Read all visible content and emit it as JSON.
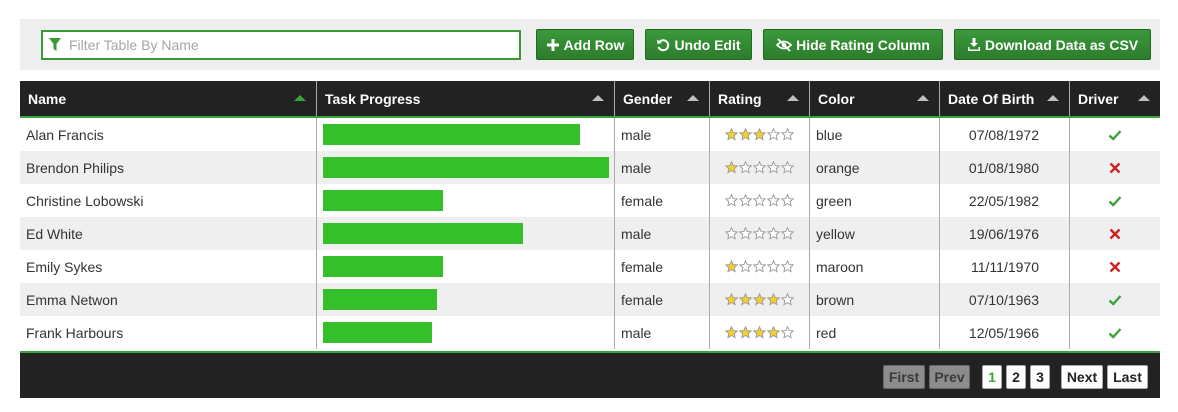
{
  "toolbar": {
    "filter_placeholder": "Filter Table By Name",
    "add_row": "Add Row",
    "undo_edit": "Undo Edit",
    "hide_rating": "Hide Rating Column",
    "download_csv": "Download Data as CSV"
  },
  "columns": [
    "Name",
    "Task Progress",
    "Gender",
    "Rating",
    "Color",
    "Date Of Birth",
    "Driver"
  ],
  "rows": [
    {
      "name": "Alan Francis",
      "progress": 90,
      "gender": "male",
      "rating": 3,
      "color": "blue",
      "dob": "07/08/1972",
      "driver": true
    },
    {
      "name": "Brendon Philips",
      "progress": 100,
      "gender": "male",
      "rating": 1,
      "color": "orange",
      "dob": "01/08/1980",
      "driver": false
    },
    {
      "name": "Christine Lobowski",
      "progress": 42,
      "gender": "female",
      "rating": 0,
      "color": "green",
      "dob": "22/05/1982",
      "driver": true
    },
    {
      "name": "Ed White",
      "progress": 70,
      "gender": "male",
      "rating": 0,
      "color": "yellow",
      "dob": "19/06/1976",
      "driver": false
    },
    {
      "name": "Emily Sykes",
      "progress": 42,
      "gender": "female",
      "rating": 1,
      "color": "maroon",
      "dob": "11/11/1970",
      "driver": false
    },
    {
      "name": "Emma Netwon",
      "progress": 40,
      "gender": "female",
      "rating": 4,
      "color": "brown",
      "dob": "07/10/1963",
      "driver": true
    },
    {
      "name": "Frank Harbours",
      "progress": 38,
      "gender": "male",
      "rating": 4,
      "color": "red",
      "dob": "12/05/1966",
      "driver": true
    }
  ],
  "pagination": {
    "first": "First",
    "prev": "Prev",
    "pages": [
      "1",
      "2",
      "3"
    ],
    "current_page": "1",
    "next": "Next",
    "last": "Last"
  },
  "colors": {
    "accent": "#3aa43a",
    "bar": "#35bf2b",
    "header_bg": "#222222",
    "star_filled": "#f2d12e",
    "star_empty": "#ffffff",
    "tick": "#3aa43a",
    "cross": "#cc2222"
  },
  "icons": {
    "filter": "funnel-icon",
    "add_row": "plus-icon",
    "undo_edit": "undo-icon",
    "hide_rating": "eye-slash-icon",
    "download_csv": "download-icon",
    "driver_yes": "check-icon",
    "driver_no": "cross-icon",
    "rating": "star-icon",
    "sort": "sort-arrow-icon"
  }
}
